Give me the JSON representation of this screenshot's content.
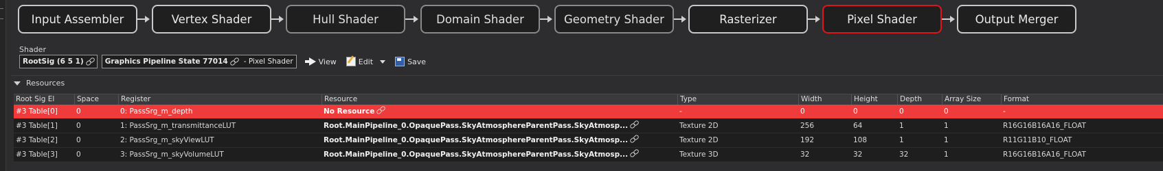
{
  "pipeline": {
    "stages": [
      {
        "label": "Input Assembler",
        "state": "enabled"
      },
      {
        "label": "Vertex Shader",
        "state": "enabled"
      },
      {
        "label": "Hull Shader",
        "state": "disabled"
      },
      {
        "label": "Domain Shader",
        "state": "disabled"
      },
      {
        "label": "Geometry Shader",
        "state": "disabled"
      },
      {
        "label": "Rasterizer",
        "state": "enabled"
      },
      {
        "label": "Pixel Shader",
        "state": "selected"
      },
      {
        "label": "Output Merger",
        "state": "enabled"
      }
    ]
  },
  "shader": {
    "section_label": "Shader",
    "root_sig": "RootSig (6 5 1)",
    "pso": "Graphics Pipeline State 77014",
    "pso_suffix": "- Pixel Shader",
    "view_label": "View",
    "edit_label": "Edit",
    "save_label": "Save"
  },
  "resources": {
    "section_label": "Resources",
    "columns": [
      "Root Sig El",
      "Space",
      "Register",
      "Resource",
      "Type",
      "Width",
      "Height",
      "Depth",
      "Array Size",
      "Format"
    ],
    "rows": [
      {
        "root_sig_el": "#3 Table[0]",
        "space": "0",
        "register": "0: PassSrg_m_depth",
        "resource": "No Resource",
        "type": "-",
        "width": "0",
        "height": "0",
        "depth": "0",
        "array_size": "0",
        "format": "-",
        "highlight": true
      },
      {
        "root_sig_el": "#3 Table[1]",
        "space": "0",
        "register": "1: PassSrg_m_transmittanceLUT",
        "resource": "Root.MainPipeline_0.OpaquePass.SkyAtmosphereParentPass.SkyAtmosp...",
        "type": "Texture 2D",
        "width": "256",
        "height": "64",
        "depth": "1",
        "array_size": "1",
        "format": "R16G16B16A16_FLOAT",
        "highlight": false
      },
      {
        "root_sig_el": "#3 Table[2]",
        "space": "0",
        "register": "2: PassSrg_m_skyViewLUT",
        "resource": "Root.MainPipeline_0.OpaquePass.SkyAtmosphereParentPass.SkyAtmosp...",
        "type": "Texture 2D",
        "width": "192",
        "height": "108",
        "depth": "1",
        "array_size": "1",
        "format": "R11G11B10_FLOAT",
        "highlight": false
      },
      {
        "root_sig_el": "#3 Table[3]",
        "space": "0",
        "register": "3: PassSrg_m_skyVolumeLUT",
        "resource": "Root.MainPipeline_0.OpaquePass.SkyAtmosphereParentPass.SkyAtmosp...",
        "type": "Texture 3D",
        "width": "32",
        "height": "32",
        "depth": "32",
        "array_size": "1",
        "format": "R16G16B16A16_FLOAT",
        "highlight": false
      }
    ]
  },
  "colors": {
    "selected_stage_border": "#e2141b",
    "highlight_row": "#ef3b3b"
  }
}
